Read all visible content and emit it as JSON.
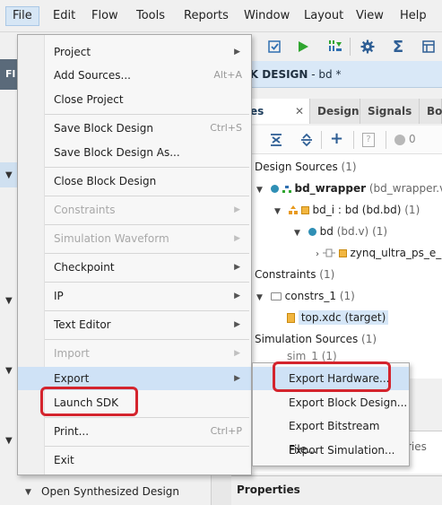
{
  "menubar": {
    "items": [
      "File",
      "Edit",
      "Flow",
      "Tools",
      "Reports",
      "Window",
      "Layout",
      "View",
      "Help"
    ]
  },
  "toolbar": {
    "icons": [
      "edit-check-icon",
      "run-icon",
      "bitstream-icon",
      "settings-icon",
      "sigma-icon"
    ]
  },
  "left_strip": {
    "dark_label": "Fl"
  },
  "header": {
    "title_prefix": "CK DESIGN",
    "title_suffix": " - bd *"
  },
  "tabs": {
    "items": [
      "rces",
      "Design",
      "Signals",
      "Boa"
    ]
  },
  "sources_toolbar": {
    "badge_count": "0"
  },
  "tree": {
    "design_sources": {
      "label": "Design Sources",
      "count": "(1)"
    },
    "bd_wrapper": {
      "name": "bd_wrapper",
      "file": "(bd_wrapper.v)",
      "count": "("
    },
    "bd_i": {
      "name": "bd_i : bd (bd.bd)",
      "count": "(1)"
    },
    "bd": {
      "name": "bd",
      "file": "(bd.v)",
      "count": "(1)"
    },
    "zynq": {
      "name": "zynq_ultra_ps_e_"
    },
    "constraints": {
      "label": "Constraints",
      "count": "(1)"
    },
    "constrs": {
      "label": "constrs_1",
      "count": "(1)"
    },
    "topxdc": {
      "label": "top.xdc (target)"
    },
    "sim_sources": {
      "label": "Simulation Sources",
      "count": "(1)"
    },
    "sim_partial": {
      "label": "sim_1 (1)"
    }
  },
  "lower_panel": {
    "tab_partial": "ries"
  },
  "properties": {
    "label": "Properties"
  },
  "left_bottom": {
    "label": "Open Synthesized Design"
  },
  "file_menu": {
    "project": "Project",
    "add_sources": "Add Sources...",
    "add_sources_accel": "Alt+A",
    "close_project": "Close Project",
    "save_bd": "Save Block Design",
    "save_bd_accel": "Ctrl+S",
    "save_bd_as": "Save Block Design As...",
    "close_bd": "Close Block Design",
    "constraints": "Constraints",
    "sim_waveform": "Simulation Waveform",
    "checkpoint": "Checkpoint",
    "ip": "IP",
    "text_editor": "Text Editor",
    "import": "Import",
    "export": "Export",
    "launch_sdk": "Launch SDK",
    "print": "Print...",
    "print_accel": "Ctrl+P",
    "exit": "Exit"
  },
  "export_menu": {
    "export_hardware": "Export Hardware...",
    "export_block_design": "Export Block Design...",
    "export_bitstream": "Export Bitstream File...",
    "export_simulation": "Export Simulation..."
  },
  "colors": {
    "highlight_ring": "#d4242d",
    "menu_hover": "#cfe2f6",
    "accent_blue": "#2f6fb0",
    "run_green": "#2fa52f"
  }
}
